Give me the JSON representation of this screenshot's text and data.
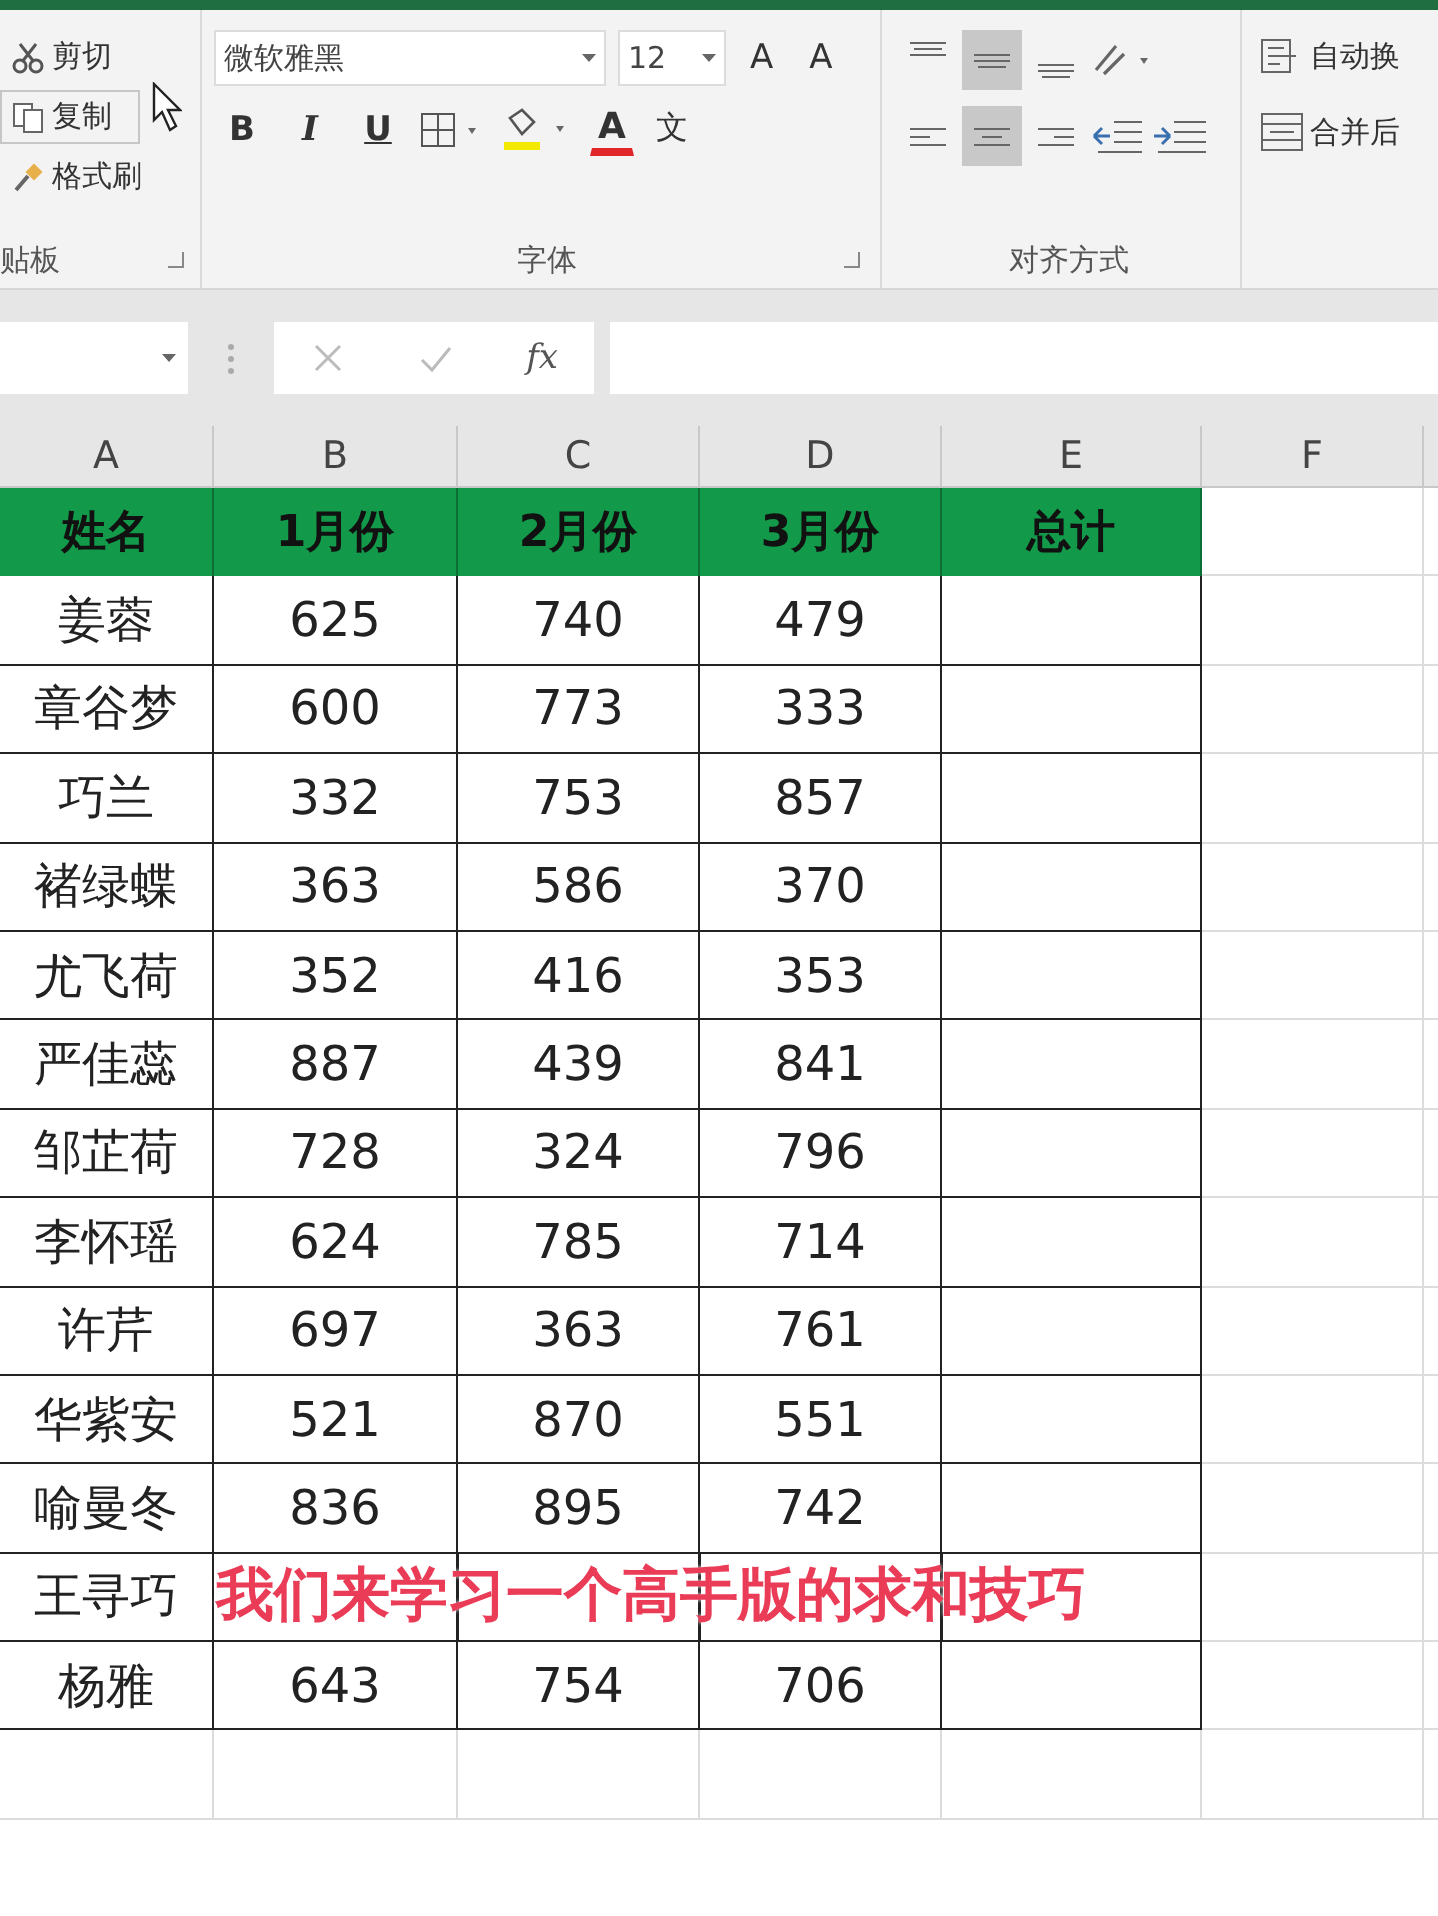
{
  "ribbon": {
    "clipboard": {
      "items": [
        {
          "kind": "cut",
          "label": "剪切"
        },
        {
          "kind": "copy",
          "label": "复制"
        },
        {
          "kind": "painter",
          "label": "格式刷"
        }
      ],
      "group_label": "贴板"
    },
    "font": {
      "name": "微软雅黑",
      "size": "12",
      "grow_glyph": "A",
      "shrink_glyph": "A",
      "style_buttons": [
        {
          "kind": "bold",
          "label": "B"
        },
        {
          "kind": "italic",
          "label": "I"
        },
        {
          "kind": "underline",
          "label": "U"
        }
      ],
      "font_color_glyph": "A",
      "phonetic_glyph": "文",
      "group_label": "字体"
    },
    "alignment": {
      "vertical": [
        {
          "kind": "top",
          "selected": false
        },
        {
          "kind": "middle",
          "selected": true
        },
        {
          "kind": "bottom",
          "selected": false
        }
      ],
      "horizontal": [
        {
          "kind": "left",
          "selected": false
        },
        {
          "kind": "center",
          "selected": true
        },
        {
          "kind": "right",
          "selected": false
        }
      ],
      "wrap_label": "自动换",
      "merge_label": "合并后",
      "group_label": "对齐方式"
    }
  },
  "formula_bar": {
    "function_label": "fx"
  },
  "columns": [
    "A",
    "B",
    "C",
    "D",
    "E",
    "F"
  ],
  "table": {
    "header": [
      "姓名",
      "1月份",
      "2月份",
      "3月份",
      "总计"
    ],
    "rows": [
      {
        "name": "姜蓉",
        "values": [
          "625",
          "740",
          "479"
        ]
      },
      {
        "name": "章谷梦",
        "values": [
          "600",
          "773",
          "333"
        ]
      },
      {
        "name": "巧兰",
        "values": [
          "332",
          "753",
          "857"
        ]
      },
      {
        "name": "褚绿蝶",
        "values": [
          "363",
          "586",
          "370"
        ]
      },
      {
        "name": "尤飞荷",
        "values": [
          "352",
          "416",
          "353"
        ]
      },
      {
        "name": "严佳蕊",
        "values": [
          "887",
          "439",
          "841"
        ]
      },
      {
        "name": "邹芷荷",
        "values": [
          "728",
          "324",
          "796"
        ]
      },
      {
        "name": "李怀瑶",
        "values": [
          "624",
          "785",
          "714"
        ]
      },
      {
        "name": "许芹",
        "values": [
          "697",
          "363",
          "761"
        ]
      },
      {
        "name": "华紫安",
        "values": [
          "521",
          "870",
          "551"
        ]
      },
      {
        "name": "喻曼冬",
        "values": [
          "836",
          "895",
          "742"
        ]
      },
      {
        "name": "王寻巧"
      },
      {
        "name": "杨雅",
        "values": [
          "643",
          "754",
          "706"
        ]
      }
    ]
  },
  "subtitle": "我们来学习一个高手版的求和技巧"
}
